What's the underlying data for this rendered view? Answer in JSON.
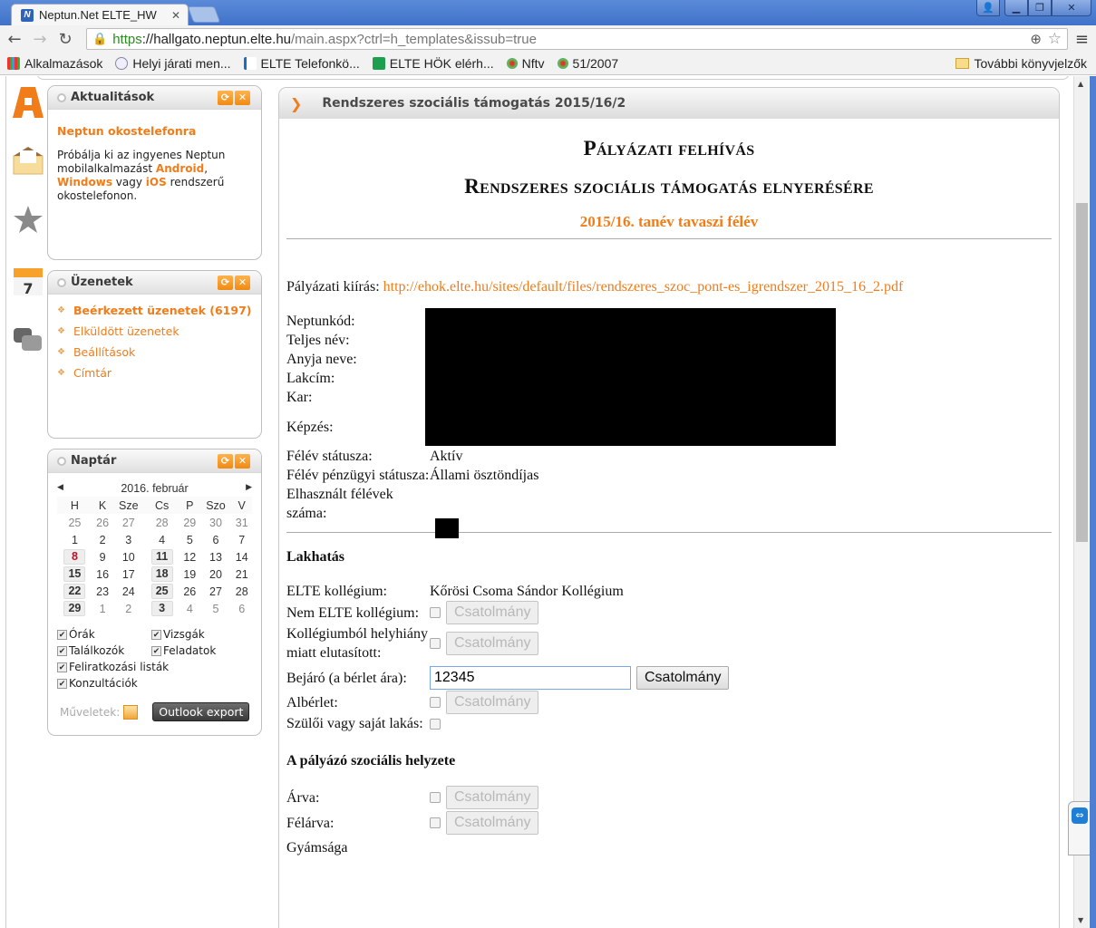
{
  "browser": {
    "tab_title": "Neptun.Net ELTE_HW",
    "tab_favicon": "neptun-N-icon",
    "url_scheme": "https",
    "url_host": "://hallgato.neptun.elte.hu",
    "url_path": "/main.aspx?ctrl=h_templates&issub=true",
    "bookmarks": [
      {
        "label": "Alkalmazások",
        "icon": "apps-grid-icon"
      },
      {
        "label": "Helyi járati men...",
        "icon": "bus-logo-icon"
      },
      {
        "label": "ELTE Telefonkö...",
        "icon": "phone-icon"
      },
      {
        "label": "ELTE HÖK elérh...",
        "icon": "sheets-icon"
      },
      {
        "label": "Nftv",
        "icon": "globe-icon"
      },
      {
        "label": "51/2007",
        "icon": "globe-icon"
      }
    ],
    "other_bookmarks": "További könyvjelzők"
  },
  "sidebar": {
    "news": {
      "title": "Aktualitások",
      "headline": "Neptun okostelefonra",
      "text_1": "Próbálja ki az ingyenes Neptun mobilalkalmazást ",
      "android": "Android",
      "comma": ",",
      "windows": "Windows",
      "text_2": " vagy ",
      "ios": "iOS",
      "text_3": " rendszerű okostelefonon."
    },
    "messages": {
      "title": "Üzenetek",
      "items": [
        {
          "label": "Beérkezett üzenetek (6197)",
          "bold": true
        },
        {
          "label": "Elküldött üzenetek"
        },
        {
          "label": "Beállítások"
        },
        {
          "label": "Címtár"
        }
      ]
    },
    "calendar": {
      "title": "Naptár",
      "month": "2016. február",
      "weekdays": [
        "H",
        "K",
        "Sze",
        "Cs",
        "P",
        "Szo",
        "V"
      ],
      "weeks": [
        [
          "25",
          "26",
          "27",
          "28",
          "29",
          "30",
          "31"
        ],
        [
          "1",
          "2",
          "3",
          "4",
          "5",
          "6",
          "7"
        ],
        [
          "8",
          "9",
          "10",
          "11",
          "12",
          "13",
          "14"
        ],
        [
          "15",
          "16",
          "17",
          "18",
          "19",
          "20",
          "21"
        ],
        [
          "22",
          "23",
          "24",
          "25",
          "26",
          "27",
          "28"
        ],
        [
          "29",
          "1",
          "2",
          "3",
          "4",
          "5",
          "6"
        ]
      ],
      "filters": [
        {
          "label": "Órák",
          "checked": true
        },
        {
          "label": "Vizsgák",
          "checked": true
        },
        {
          "label": "Találkozók",
          "checked": true
        },
        {
          "label": "Feladatok",
          "checked": true
        },
        {
          "label": "Feliratkozási listák",
          "checked": true
        },
        {
          "label": "Konzultációk",
          "checked": true
        }
      ],
      "ops_label": "Műveletek:",
      "export_button": "Outlook export"
    }
  },
  "main": {
    "header": "Rendszeres szociális támogatás 2015/16/2",
    "title_1": "Pályázati felhívás",
    "title_2": "Rendszeres szociális támogatás elnyerésére",
    "subtitle": "2015/16. tanév tavaszi félév",
    "kiiras_label": "Pályázati kiírás: ",
    "kiiras_link": "http://ehok.elte.hu/sites/default/files/rendszeres_szoc_pont-es_igrendszer_2015_16_2.pdf",
    "personal": {
      "neptun_label": "Neptunkód:",
      "name_label": "Teljes név:",
      "mother_label": "Anyja neve:",
      "address_label": "Lakcím:",
      "faculty_label": "Kar:",
      "training_label": "Képzés:",
      "status_label": "Félév státusza:",
      "status_value": "Aktív",
      "fin_label": "Félév pénzügyi státusza:",
      "fin_value": "Állami ösztöndíjas",
      "used_label": "Elhasznált félévek száma:"
    },
    "housing": {
      "title": "Lakhatás",
      "elte_label": "ELTE kollégium:",
      "elte_value": "Kőrösi Csoma Sándor Kollégium",
      "nonelte_label": "Nem ELTE kollégium:",
      "rejected_label": "Kollégiumból helyhiány miatt elutasított:",
      "commuter_label": "Bejáró (a bérlet ára):",
      "commuter_value": "12345",
      "rent_label": "Albérlet:",
      "own_label": "Szülői vagy saját lakás:"
    },
    "social": {
      "title": "A pályázó szociális helyzete",
      "orphan_label": "Árva:",
      "halforphan_label": "Félárva:",
      "guardian_label": "Gyámsága"
    },
    "attach_label": "Csatolmány"
  }
}
